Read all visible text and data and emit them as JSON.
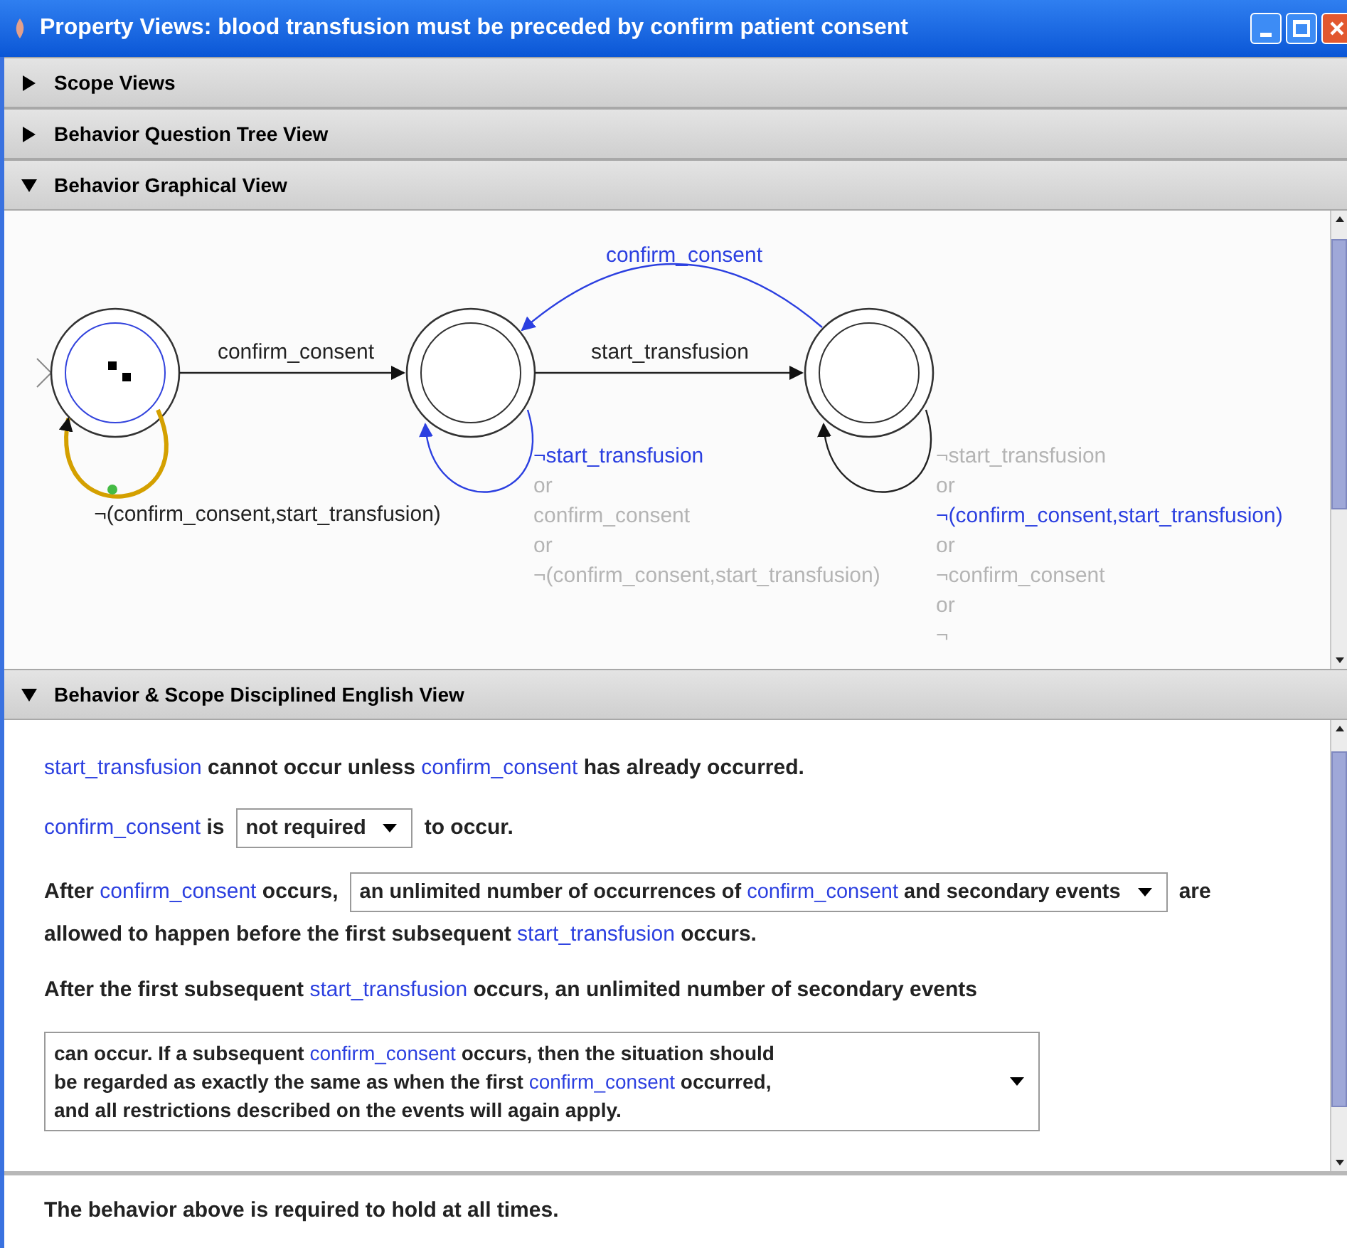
{
  "window": {
    "title": "Property Views: blood transfusion must be preceded by confirm patient consent"
  },
  "sections": [
    {
      "title": "Scope Views",
      "expanded": false
    },
    {
      "title": "Behavior Question Tree View",
      "expanded": false
    },
    {
      "title": "Behavior Graphical View",
      "expanded": true
    },
    {
      "title": "Behavior & Scope Disciplined English View",
      "expanded": true
    }
  ],
  "graph": {
    "states": [
      {
        "initial": true,
        "current": true
      },
      {
        "initial": false,
        "current": false
      },
      {
        "initial": false,
        "current": false
      }
    ],
    "transitions": [
      {
        "selected": false,
        "active": true,
        "lines": [
          {
            "text": "confirm_consent",
            "active": true,
            "dimmed": false
          }
        ]
      },
      {
        "selected": false,
        "active": false,
        "lines": [
          {
            "text": "confirm_consent",
            "active": false,
            "dimmed": false
          }
        ]
      },
      {
        "selected": false,
        "active": false,
        "lines": [
          {
            "text": "start_transfusion",
            "active": false,
            "dimmed": false
          }
        ]
      },
      {
        "selected": false,
        "active": true,
        "lines": [
          {
            "text": "¬start_transfusion",
            "active": true,
            "dimmed": false
          },
          {
            "text": "or",
            "active": false,
            "dimmed": true
          },
          {
            "text": "confirm_consent",
            "active": false,
            "dimmed": true
          },
          {
            "text": "or",
            "active": false,
            "dimmed": true
          },
          {
            "text": "¬(confirm_consent,start_transfusion)",
            "active": false,
            "dimmed": true
          }
        ]
      },
      {
        "selected": false,
        "active": false,
        "lines": [
          {
            "text": "¬start_transfusion",
            "active": false,
            "dimmed": true
          },
          {
            "text": "or",
            "active": false,
            "dimmed": true
          },
          {
            "text": "¬(confirm_consent,start_transfusion)",
            "active": true,
            "dimmed": false
          },
          {
            "text": "or",
            "active": false,
            "dimmed": true
          },
          {
            "text": "¬confirm_consent",
            "active": false,
            "dimmed": true
          },
          {
            "text": "or",
            "active": false,
            "dimmed": true
          },
          {
            "text": "¬",
            "active": false,
            "dimmed": true
          }
        ]
      },
      {
        "selected": true,
        "active": false,
        "lines": [
          {
            "text": "¬(confirm_consent,start_transfusion)",
            "active": false,
            "dimmed": false
          }
        ]
      }
    ]
  },
  "english": [
    {
      "kind": "sentence",
      "parts": [
        {
          "kind": "event",
          "text": "start_transfusion"
        },
        {
          "kind": "plain",
          "text": " cannot occur unless "
        },
        {
          "kind": "event",
          "text": "confirm_consent"
        },
        {
          "kind": "plain",
          "text": " has already occurred."
        }
      ]
    },
    {
      "kind": "sentence",
      "parts": [
        {
          "kind": "event",
          "text": "confirm_consent"
        },
        {
          "kind": "plain",
          "text": " is"
        },
        {
          "kind": "dropdown",
          "lines": [
            [
              {
                "kind": "plain",
                "text": "not required"
              }
            ]
          ]
        },
        {
          "kind": "plain",
          "text": "to occur."
        }
      ]
    },
    {
      "kind": "sentence",
      "parts": [
        {
          "kind": "plain",
          "text": "After "
        },
        {
          "kind": "event",
          "text": "confirm_consent"
        },
        {
          "kind": "plain",
          "text": " occurs,"
        },
        {
          "kind": "dropdown",
          "lines": [
            [
              {
                "kind": "plain",
                "text": "an unlimited number of occurrences of "
              },
              {
                "kind": "event",
                "text": "confirm_consent"
              },
              {
                "kind": "plain",
                "text": " and secondary events"
              }
            ]
          ]
        },
        {
          "kind": "plain",
          "text": "are"
        }
      ]
    },
    {
      "kind": "continuation",
      "parts": [
        {
          "kind": "plain",
          "text": "allowed to happen before the first subsequent "
        },
        {
          "kind": "event",
          "text": "start_transfusion"
        },
        {
          "kind": "plain",
          "text": " occurs."
        }
      ]
    },
    {
      "kind": "sentence",
      "parts": [
        {
          "kind": "plain",
          "text": "After the first subsequent "
        },
        {
          "kind": "event",
          "text": "start_transfusion"
        },
        {
          "kind": "plain",
          "text": " occurs, an unlimited number of secondary events"
        }
      ]
    },
    {
      "kind": "block_dropdown",
      "lines": [
        [
          {
            "kind": "plain",
            "text": "can occur. If a subsequent "
          },
          {
            "kind": "event",
            "text": "confirm_consent"
          },
          {
            "kind": "plain",
            "text": " occurs, then the situation should"
          }
        ],
        [
          {
            "kind": "plain",
            "text": "be regarded as exactly the same as when the first "
          },
          {
            "kind": "event",
            "text": "confirm_consent"
          },
          {
            "kind": "plain",
            "text": " occurred,"
          }
        ],
        [
          {
            "kind": "plain",
            "text": "and all restrictions described on the events will again apply."
          }
        ]
      ]
    }
  ],
  "footer": {
    "text": "The behavior above is required to hold at all times."
  }
}
